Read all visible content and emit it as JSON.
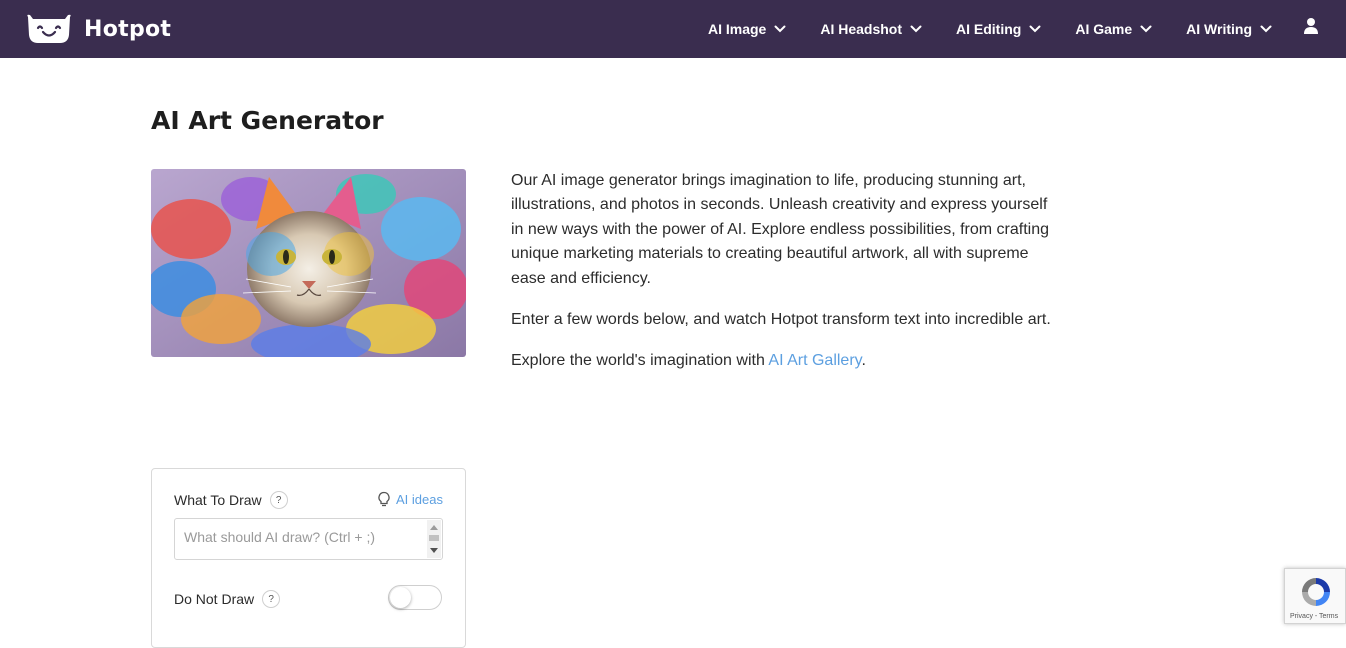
{
  "brand": {
    "name": "Hotpot"
  },
  "nav": {
    "items": [
      {
        "label": "AI Image"
      },
      {
        "label": "AI Headshot"
      },
      {
        "label": "AI Editing"
      },
      {
        "label": "AI Game"
      },
      {
        "label": "AI Writing"
      }
    ]
  },
  "page": {
    "title": "AI Art Generator",
    "paragraphs": [
      "Our AI image generator brings imagination to life, producing stunning art, illustrations, and photos in seconds. Unleash creativity and express yourself in new ways with the power of AI. Explore endless possibilities, from crafting unique marketing materials to creating beautiful artwork, all with supreme ease and efficiency.",
      "Enter a few words below, and watch Hotpot transform text into incredible art."
    ],
    "explore_prefix": "Explore the world's imagination with ",
    "explore_link": "AI Art Gallery",
    "explore_suffix": "."
  },
  "form": {
    "what_to_draw_label": "What To Draw",
    "help_glyph": "?",
    "ai_ideas_label": "AI ideas",
    "prompt_placeholder": "What should AI draw? (Ctrl + ;)",
    "prompt_value": "",
    "do_not_draw_label": "Do Not Draw",
    "do_not_draw_enabled": false
  },
  "recaptcha": {
    "footer": "Privacy - Terms"
  },
  "colors": {
    "topbar": "#3a2d4f",
    "link": "#5c9fe0"
  },
  "icons": [
    "hotpot-logo-icon",
    "chevron-down-icon",
    "user-icon",
    "help-icon",
    "lightbulb-icon",
    "recaptcha-icon"
  ]
}
